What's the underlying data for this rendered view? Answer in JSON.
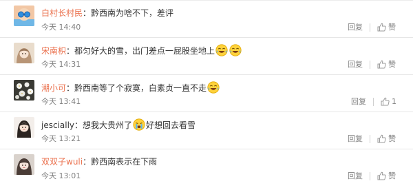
{
  "comments": [
    {
      "name": "白村长村民",
      "text_before": "：黔西南为啥不下，差评",
      "emoji_1": "",
      "text_mid": "",
      "emoji_2": "",
      "time": "今天 14:40",
      "reply_label": "回复",
      "like_label": "赞",
      "like_count": ""
    },
    {
      "name": "宋南枳",
      "text_before": "：都匀好大的雪，出门差点一屁股坐地上",
      "emoji_1": "laughing-crying-emoji",
      "text_mid": "",
      "emoji_2": "laughing-crying-emoji",
      "time": "今天 14:31",
      "reply_label": "回复",
      "like_label": "赞",
      "like_count": ""
    },
    {
      "name": "潮小可",
      "text_before": "：黔西南等了个寂寞，白素贞一直不走",
      "emoji_1": "laughing-crying-emoji",
      "text_mid": "",
      "emoji_2": "",
      "time": "今天 13:41",
      "reply_label": "回复",
      "like_label": "",
      "like_count": "1"
    },
    {
      "name": "jescially",
      "text_before": "：想我大贵州了",
      "emoji_1": "crying-emoji",
      "text_mid": "好想回去看雪",
      "emoji_2": "",
      "time": "今天 13:21",
      "reply_label": "回复",
      "like_label": "赞",
      "like_count": ""
    },
    {
      "name": "双双子wuli",
      "text_before": "：黔西南表示在下雨",
      "emoji_1": "",
      "text_mid": "",
      "emoji_2": "",
      "time": "今天 13:01",
      "reply_label": "回复",
      "like_label": "赞",
      "like_count": ""
    }
  ],
  "colors": {
    "name": "#eb7350",
    "text": "#333333",
    "meta": "#808080",
    "divider": "#e6e6e6"
  }
}
